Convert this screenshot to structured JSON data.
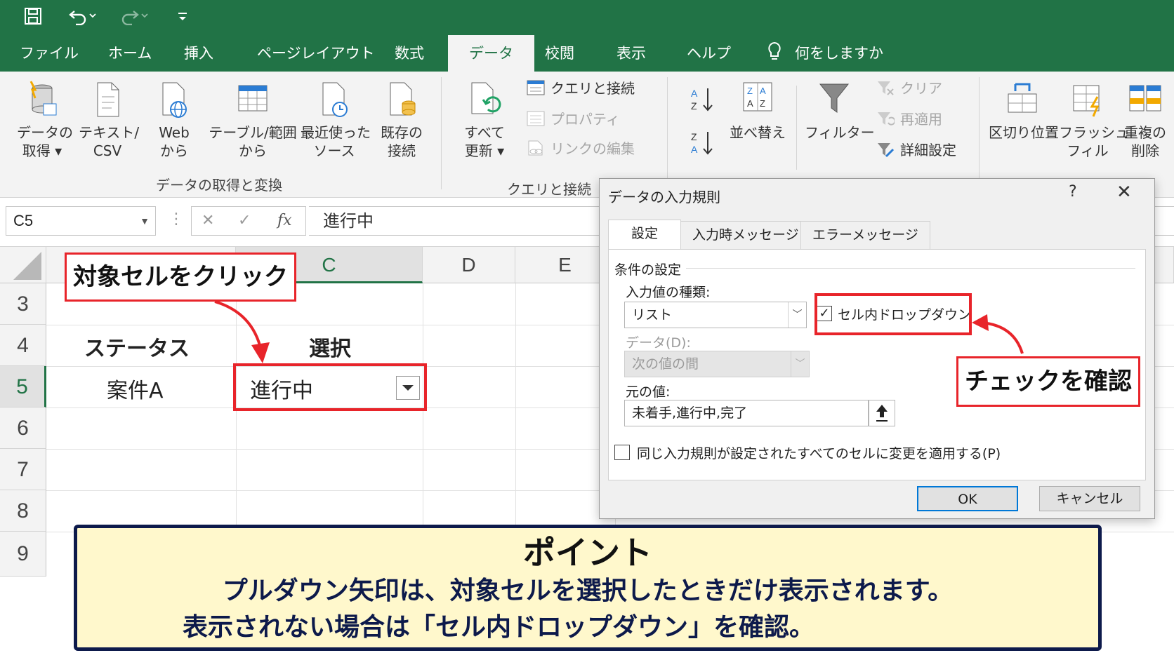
{
  "quick_access": {
    "save_icon": "save-icon",
    "undo_icon": "undo-icon",
    "redo_icon": "redo-icon",
    "customize_icon": "customize-icon"
  },
  "tabs": [
    "ファイル",
    "ホーム",
    "挿入",
    "ページレイアウト",
    "数式",
    "データ",
    "校閲",
    "表示",
    "ヘルプ"
  ],
  "active_tab": "データ",
  "tell_me": "何をしますか",
  "ribbon": {
    "get_data": {
      "label": "データの取得と変換",
      "buttons": [
        {
          "line1": "データの",
          "line2": "取得 ▾"
        },
        {
          "line1": "テキスト/",
          "line2": "CSV"
        },
        {
          "line1": "Web",
          "line2": "から"
        },
        {
          "line1": "テーブル/範囲",
          "line2": "から"
        },
        {
          "line1": "最近使った",
          "line2": "ソース"
        },
        {
          "line1": "既存の",
          "line2": "接続"
        }
      ]
    },
    "queries": {
      "label": "クエリと接続",
      "refresh": {
        "line1": "すべて",
        "line2": "更新 ▾"
      },
      "items": [
        "クエリと接続",
        "プロパティ",
        "リンクの編集"
      ]
    },
    "sort": {
      "sort_label": "並べ替え"
    },
    "filter": {
      "filter_label": "フィルター",
      "items": [
        "クリア",
        "再適用",
        "詳細設定"
      ]
    },
    "tools": [
      {
        "line1": "区切り位置",
        "line2": ""
      },
      {
        "line1": "フラッシュ",
        "line2": "フィル"
      },
      {
        "line1": "重複の",
        "line2": "削除"
      }
    ]
  },
  "formula_bar": {
    "name_box": "C5",
    "cancel": "✕",
    "enter": "✓",
    "fx": "fx",
    "value": "進行中"
  },
  "grid": {
    "columns": [
      "C",
      "D",
      "E"
    ],
    "rows": [
      "3",
      "4",
      "5",
      "6",
      "7",
      "8",
      "9"
    ],
    "cells": {
      "b4": "ステータス",
      "c4": "選択",
      "b5": "案件A",
      "c5": "進行中"
    }
  },
  "annotations": {
    "click_callout": "対象セルをクリック",
    "check_callout": "チェックを確認"
  },
  "dialog": {
    "title": "データの入力規則",
    "help": "?",
    "close": "✕",
    "tabs": [
      "設定",
      "入力時メッセージ",
      "エラーメッセージ"
    ],
    "section": "条件の設定",
    "allow_label": "入力値の種類:",
    "allow_value": "リスト",
    "dropdown_checkbox_label": "セル内ドロップダウン",
    "data_label": "データ(D):",
    "data_value": "次の値の間",
    "source_label": "元の値:",
    "source_value": "未着手,進行中,完了",
    "apply_all_label": "同じ入力規則が設定されたすべてのセルに変更を適用する(P)",
    "ok": "OK",
    "cancel": "キャンセル"
  },
  "point_box": {
    "title": "ポイント",
    "line1": "プルダウン矢印は、対象セルを選択したときだけ表示されます。",
    "line2": "表示されない場合は「セル内ドロップダウン」を確認。"
  },
  "colors": {
    "excel_green": "#217346",
    "annotation_red": "#e8242a",
    "point_bg": "#fff8cc",
    "point_border": "#0d1a4b"
  }
}
